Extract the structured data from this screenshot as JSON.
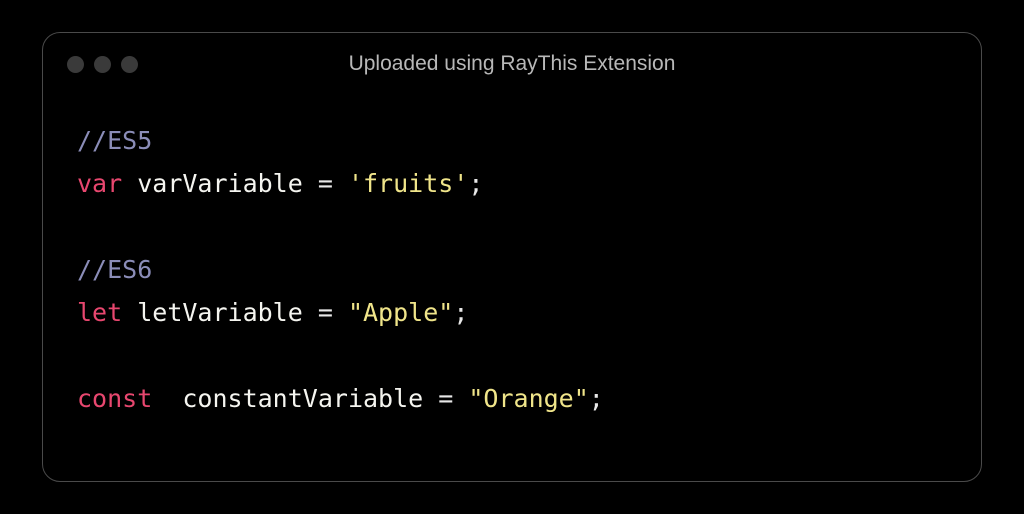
{
  "window": {
    "title": "Uploaded using RayThis Extension"
  },
  "code": {
    "line1": {
      "comment": "//ES5"
    },
    "line2": {
      "keyword": "var",
      "ident": "varVariable",
      "op": " = ",
      "str": "'fruits'",
      "end": ";"
    },
    "line3": {
      "blank": ""
    },
    "line4": {
      "comment": "//ES6"
    },
    "line5": {
      "keyword": "let",
      "ident": "letVariable",
      "op": " = ",
      "str": "\"Apple\"",
      "end": ";"
    },
    "line6": {
      "blank": ""
    },
    "line7": {
      "keyword": "const",
      "gap": "  ",
      "ident": "constantVariable",
      "op": " = ",
      "str": "\"Orange\"",
      "end": ";"
    }
  }
}
